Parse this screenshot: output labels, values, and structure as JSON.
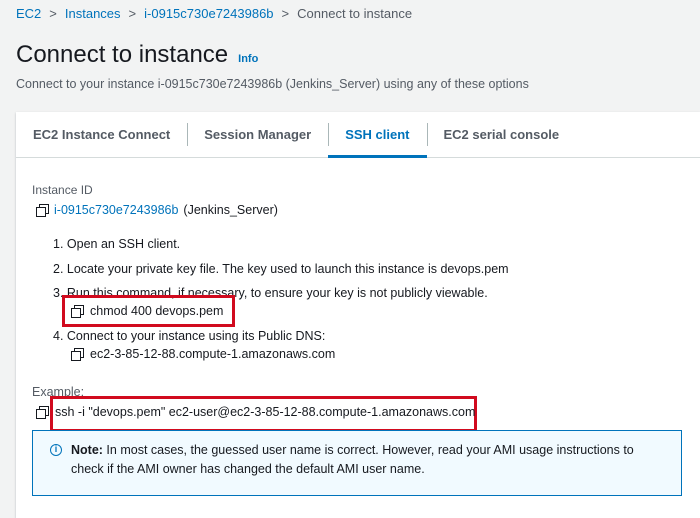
{
  "breadcrumb": {
    "items": [
      "EC2",
      "Instances",
      "i-0915c730e7243986b",
      "Connect to instance"
    ],
    "separator": ">"
  },
  "header": {
    "title": "Connect to instance",
    "info_label": "Info",
    "subtitle": "Connect to your instance i-0915c730e7243986b (Jenkins_Server) using any of these options"
  },
  "tabs": [
    {
      "label": "EC2 Instance Connect",
      "active": false
    },
    {
      "label": "Session Manager",
      "active": false
    },
    {
      "label": "SSH client",
      "active": true
    },
    {
      "label": "EC2 serial console",
      "active": false
    }
  ],
  "ssh": {
    "instance_id_label": "Instance ID",
    "instance_id": "i-0915c730e7243986b",
    "instance_name": "(Jenkins_Server)",
    "steps": [
      "1. Open an SSH client.",
      "2. Locate your private key file. The key used to launch this instance is devops.pem",
      "3. Run this command, if necessary, to ensure your key is not publicly viewable.",
      "4. Connect to your instance using its Public DNS:"
    ],
    "chmod_command": "chmod 400 devops.pem",
    "public_dns": "ec2-3-85-12-88.compute-1.amazonaws.com",
    "example_label": "Example:",
    "example_command": "ssh -i \"devops.pem\" ec2-user@ec2-3-85-12-88.compute-1.amazonaws.com"
  },
  "note": {
    "bold": "Note:",
    "text": " In most cases, the guessed user name is correct. However, read your AMI usage instructions to check if the AMI owner has changed the default AMI user name."
  },
  "colors": {
    "link": "#0073bb",
    "highlight_box": "#d10a1e",
    "note_bg": "#f1faff"
  },
  "icons": [
    "copy-icon",
    "info-icon",
    "chevron-right-icon"
  ]
}
